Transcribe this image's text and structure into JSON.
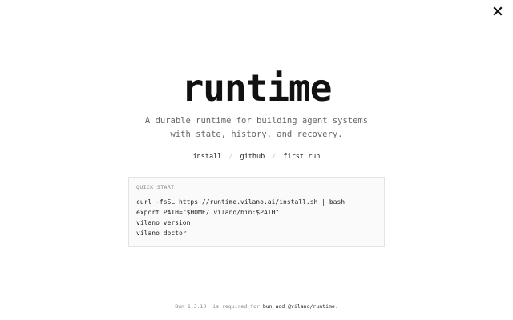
{
  "close": {
    "icon": "close-icon"
  },
  "hero": {
    "title": "runtime",
    "subtitle_line1": "A durable runtime for building agent systems",
    "subtitle_line2": "with state, history, and recovery."
  },
  "nav": {
    "links": [
      "install",
      "github",
      "first run"
    ],
    "separator": "/"
  },
  "quick_start": {
    "label": "QUICK START",
    "lines": [
      "curl -fsSL https://runtime.vilano.ai/install.sh | bash",
      "export PATH=\"$HOME/.vilano/bin:$PATH\"",
      "vilano version",
      "vilano doctor"
    ]
  },
  "footer": {
    "prefix": "Bun 1.3.10+ is required for ",
    "command": "bun add @vilano/runtime",
    "suffix": "."
  },
  "colors": {
    "background": "#ffffff",
    "title": "#111111",
    "muted": "#666666",
    "code_bg": "#fafafa",
    "code_border": "#e3e3e3"
  }
}
